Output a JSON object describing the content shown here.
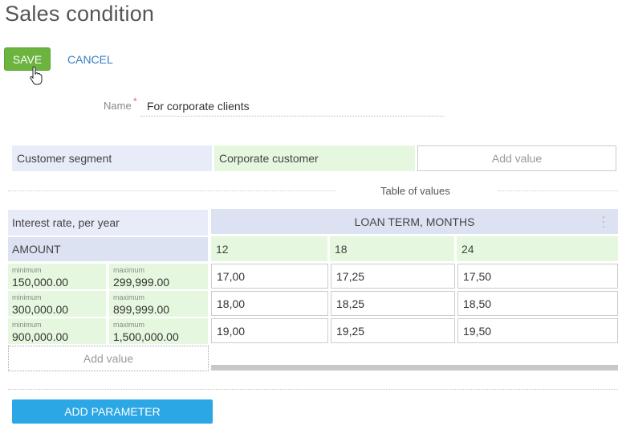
{
  "page": {
    "title": "Sales condition"
  },
  "toolbar": {
    "save_label": "SAVE",
    "cancel_label": "CANCEL"
  },
  "name_field": {
    "label": "Name",
    "required_mark": "*",
    "value": "For corporate clients"
  },
  "segment": {
    "label": "Customer segment",
    "value": "Corporate customer",
    "add_value": "Add value"
  },
  "table": {
    "title": "Table of values",
    "row_param_label": "Interest rate, per year",
    "column_header": "LOAN TERM, MONTHS",
    "amount_label": "AMOUNT",
    "terms": [
      "12",
      "18",
      "24"
    ],
    "min_label": "minimum",
    "max_label": "maximum",
    "rows": [
      {
        "min": "150,000.00",
        "max": "299,999.00",
        "rates": [
          "17,00",
          "17,25",
          "17,50"
        ]
      },
      {
        "min": "300,000.00",
        "max": "899,999.00",
        "rates": [
          "18,00",
          "18,25",
          "18,50"
        ]
      },
      {
        "min": "900,000.00",
        "max": "1,500,000.00",
        "rates": [
          "19,00",
          "19,25",
          "19,50"
        ]
      }
    ],
    "add_value": "Add value"
  },
  "footer": {
    "add_parameter_label": "ADD PARAMETER"
  },
  "colors": {
    "save_green": "#6cb33f",
    "cancel_blue": "#3a7fc1",
    "add_parameter_blue": "#2ba7e6",
    "header_lavender": "#e8ecf9",
    "value_green": "#e6f7df"
  }
}
